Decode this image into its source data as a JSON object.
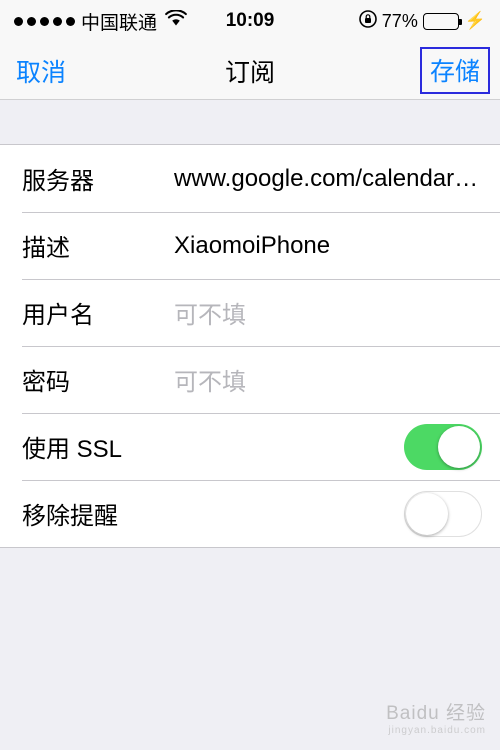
{
  "status_bar": {
    "signal_dots": 5,
    "carrier": "中国联通",
    "wifi_icon": "wifi-icon",
    "time": "10:09",
    "lock_icon": "rotation-lock-icon",
    "battery_percent": "77%",
    "battery_level": 77,
    "charging_icon": "bolt-icon",
    "battery_color": "#4cd964"
  },
  "nav": {
    "cancel_label": "取消",
    "title": "订阅",
    "save_label": "存储",
    "tint_color": "#0b83ff",
    "highlight_color": "#2b2bdd"
  },
  "form": {
    "rows": [
      {
        "label": "服务器",
        "value": "www.google.com/calendar…",
        "placeholder": false,
        "type": "text"
      },
      {
        "label": "描述",
        "value": "XiaomoiPhone",
        "placeholder": false,
        "type": "text"
      },
      {
        "label": "用户名",
        "value": "可不填",
        "placeholder": true,
        "type": "text"
      },
      {
        "label": "密码",
        "value": "可不填",
        "placeholder": true,
        "type": "text"
      },
      {
        "label": "使用 SSL",
        "value": "",
        "placeholder": false,
        "type": "toggle",
        "on": true
      },
      {
        "label": "移除提醒",
        "value": "",
        "placeholder": false,
        "type": "toggle",
        "on": false
      }
    ]
  },
  "watermark": {
    "main": "Baidu 经验",
    "sub": "jingyan.baidu.com"
  }
}
